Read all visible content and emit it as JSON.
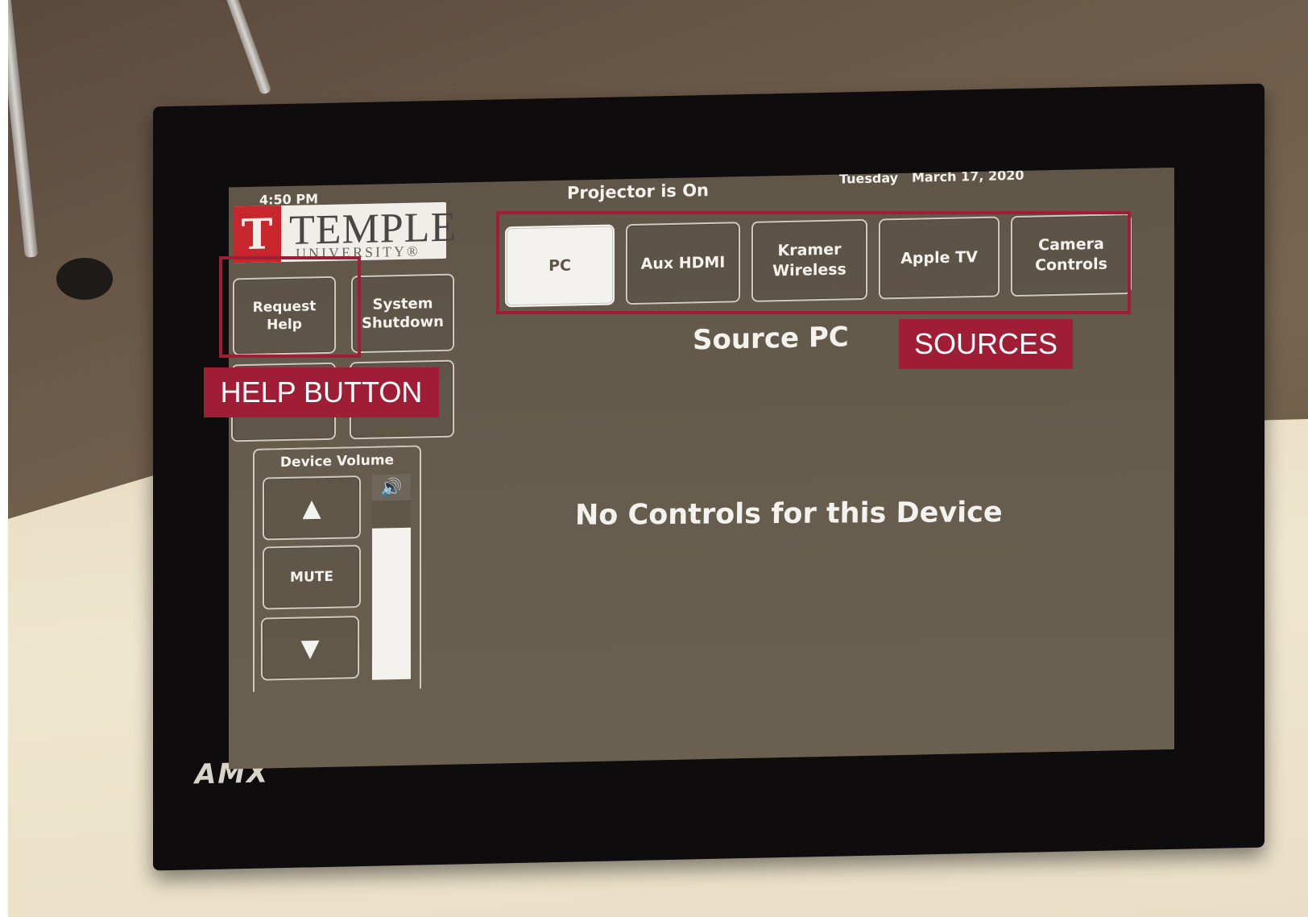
{
  "screen": {
    "time": "4:50 PM",
    "status": "Projector is On",
    "day": "Tuesday",
    "date": "March 17, 2020",
    "logo": {
      "name": "TEMPLE",
      "subtitle": "UNIVERSITY®",
      "mark": "T"
    },
    "buttons": {
      "request_help": "Request Help",
      "system_shutdown": "System Shutdown"
    },
    "volume": {
      "title": "Device Volume",
      "up_icon": "▲",
      "mute": "MUTE",
      "down_icon": "▼",
      "speaker_icon": "🔊",
      "level": 0.74
    },
    "sources": [
      {
        "label": "PC",
        "selected": true
      },
      {
        "label": "Aux HDMI",
        "selected": false
      },
      {
        "label": "Kramer Wireless",
        "selected": false
      },
      {
        "label": "Apple TV",
        "selected": false
      },
      {
        "label": "Camera Controls",
        "selected": false
      }
    ],
    "source_title": "Source PC",
    "message": "No Controls for this Device"
  },
  "device": {
    "brand": "AMX"
  },
  "annotations": {
    "help_label": "HELP BUTTON",
    "sources_label": "SOURCES",
    "color": "#9f1d35"
  }
}
